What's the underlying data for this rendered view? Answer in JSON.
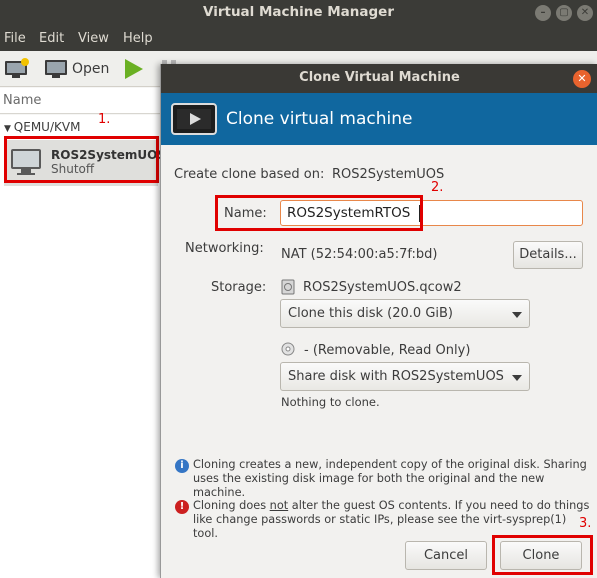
{
  "window": {
    "title": "Virtual Machine Manager"
  },
  "menu": [
    "File",
    "Edit",
    "View",
    "Help"
  ],
  "toolbar": {
    "open_label": "Open"
  },
  "vm_list": {
    "column_header": "Name",
    "group": "QEMU/KVM",
    "vm": {
      "name": "ROS2SystemUOS",
      "status": "Shutoff"
    }
  },
  "dialog": {
    "title": "Clone Virtual Machine",
    "banner": "Clone virtual machine",
    "based_on_label": "Create clone based on:",
    "based_on_value": "ROS2SystemUOS",
    "name_label": "Name:",
    "name_value": "ROS2SystemRTOS",
    "networking_label": "Networking:",
    "networking_value": "NAT (52:54:00:a5:7f:bd)",
    "details_button": "Details...",
    "storage_label": "Storage:",
    "disk1_name": "ROS2SystemUOS.qcow2",
    "disk1_option": "Clone this disk (20.0 GiB)",
    "disk2_name": "- (Removable, Read Only)",
    "disk2_option": "Share disk with ROS2SystemUOS",
    "nothing_to_clone": "Nothing to clone.",
    "note1": "Cloning creates a new, independent copy of the original disk. Sharing uses the existing disk image for both the original and the new machine.",
    "note2_prefix": "Cloning does ",
    "note2_emph": "not",
    "note2_suffix": " alter the guest OS contents. If you need to do things like change passwords or static IPs, please see the virt-sysprep(1) tool.",
    "cancel_button": "Cancel",
    "clone_button": "Clone"
  },
  "annotations": {
    "step1": "1.",
    "step2": "2.",
    "step3": "3."
  },
  "colors": {
    "accent_banner": "#10679f",
    "annotation_red": "#e00000",
    "close_orange": "#e8632e"
  }
}
